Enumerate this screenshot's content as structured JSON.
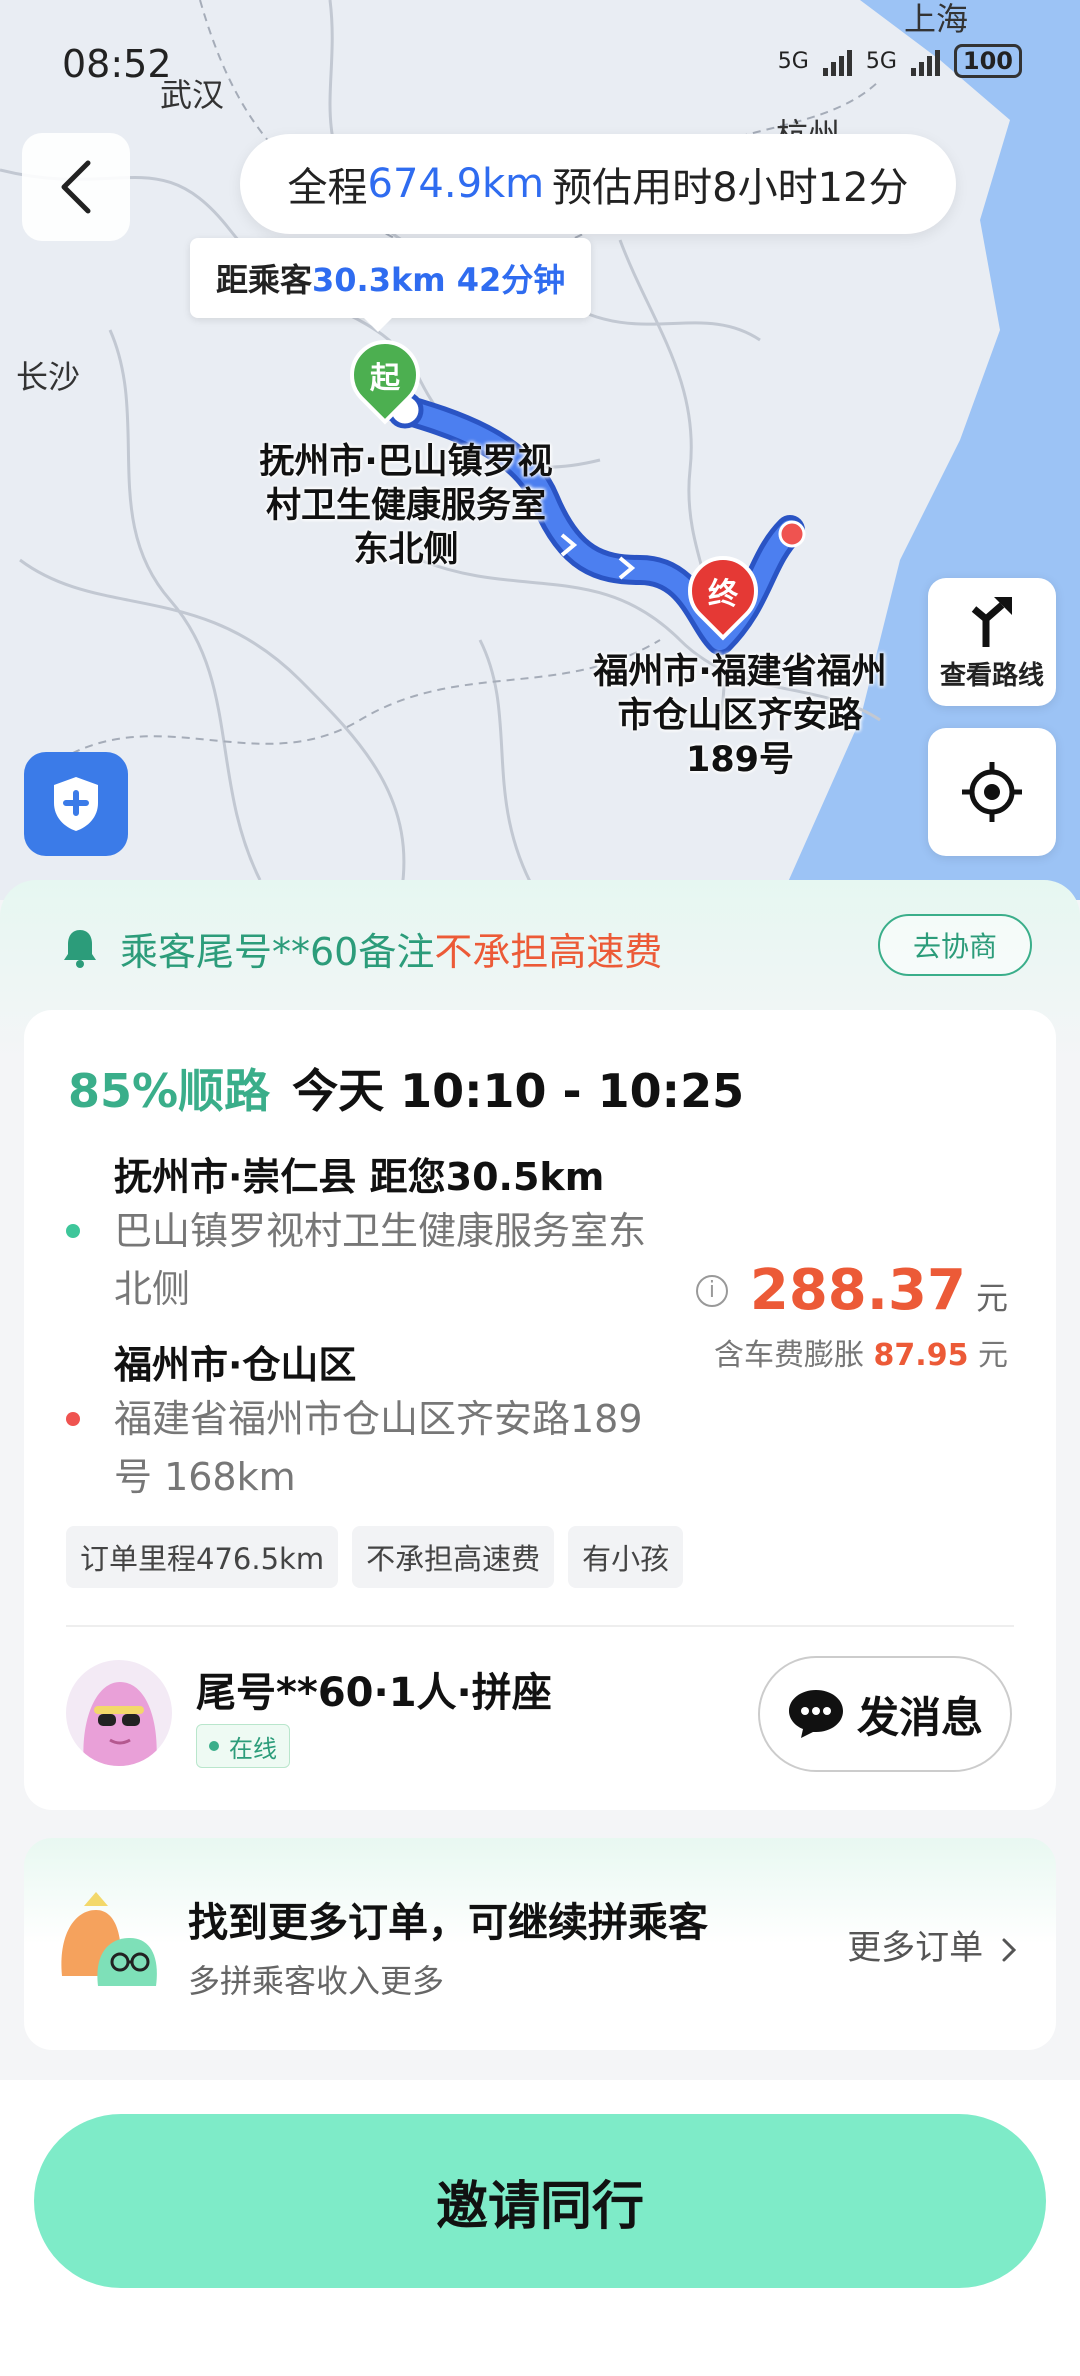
{
  "status_bar": {
    "time": "08:52",
    "network_1": "5G",
    "network_2": "5G",
    "battery": "100"
  },
  "map": {
    "cities": {
      "wuhan": "武汉",
      "changsha": "长沙",
      "shanghai": "上海",
      "hangzhou": "杭州"
    },
    "trip_summary": {
      "prefix": "全程",
      "distance": "674.9km",
      "eta": "预估用时8小时12分"
    },
    "pickup_tip": {
      "prefix": "距乘客",
      "value": "30.3km 42分钟"
    },
    "start_marker": "起",
    "end_marker": "终",
    "start_label": "抚州市·巴山镇罗视村卫生健康服务室东北侧",
    "end_label": "福州市·福建省福州市仓山区齐安路189号",
    "view_route_label": "查看路线"
  },
  "notice": {
    "text_prefix": "乘客尾号**60备注",
    "text_warn": "不承担高速费",
    "negotiate_label": "去协商"
  },
  "order": {
    "match": "85%顺路",
    "time": "今天 10:10 - 10:25",
    "pickup_title": "抚州市·崇仁县 距您30.5km",
    "pickup_addr": "巴山镇罗视村卫生健康服务室东北侧",
    "dropoff_title": "福州市·仓山区",
    "dropoff_addr": "福建省福州市仓山区齐安路189号  168km",
    "price": "288.37",
    "price_unit": "元",
    "surge_label": "含车费膨胀",
    "surge_amount": "87.95",
    "surge_unit": "元",
    "info_icon": "i",
    "tags": [
      "订单里程476.5km",
      "不承担高速费",
      "有小孩"
    ]
  },
  "passenger": {
    "name": "尾号**60·1人·拼座",
    "status": "在线",
    "message_label": "发消息"
  },
  "more_orders": {
    "title": "找到更多订单，可继续拼乘客",
    "subtitle": "多拼乘客收入更多",
    "link": "更多订单"
  },
  "primary_action": {
    "label": "邀请同行"
  },
  "colors": {
    "accent_green": "#3aae8a",
    "price_red": "#ec5a37",
    "route_blue": "#3f6fe0",
    "button_mint": "#7eebc8"
  }
}
